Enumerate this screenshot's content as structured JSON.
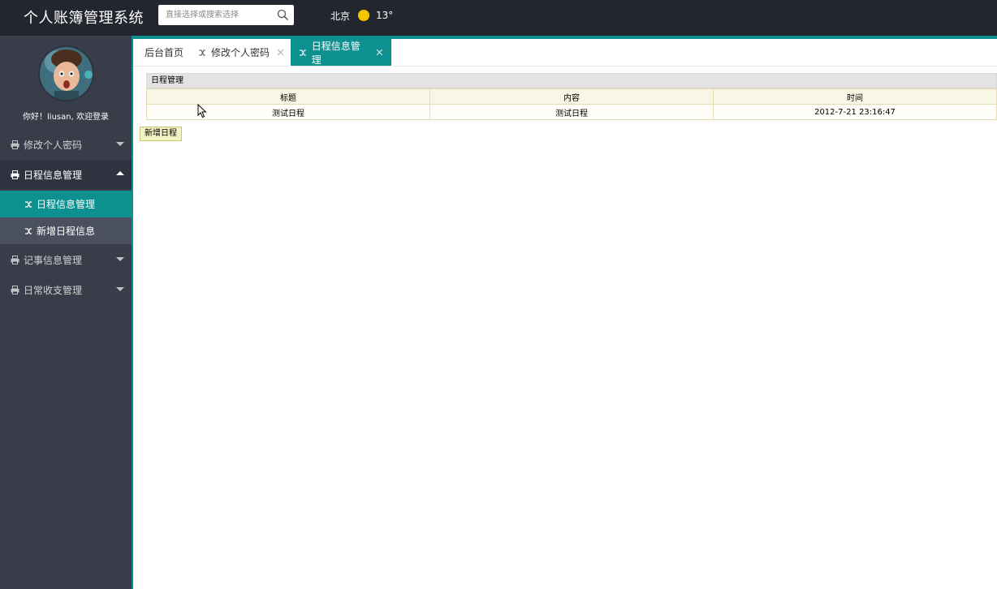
{
  "header": {
    "app_title": "个人账簿管理系统",
    "search_placeholder": "直接选择或搜索选择",
    "weather": {
      "city": "北京",
      "temperature": "13°",
      "icon": "sun-icon"
    }
  },
  "sidebar": {
    "welcome": "你好！liusan, 欢迎登录",
    "groups": [
      {
        "label": "修改个人密码",
        "expanded": false
      },
      {
        "label": "日程信息管理",
        "expanded": true,
        "items": [
          {
            "label": "日程信息管理",
            "active": true
          },
          {
            "label": "新增日程信息",
            "active": false
          }
        ]
      },
      {
        "label": "记事信息管理",
        "expanded": false
      },
      {
        "label": "日常收支管理",
        "expanded": false
      }
    ]
  },
  "tabs": [
    {
      "label": "后台首页",
      "closable": false,
      "active": false
    },
    {
      "label": "修改个人密码",
      "closable": true,
      "active": false
    },
    {
      "label": "日程信息管理",
      "closable": true,
      "active": true
    }
  ],
  "panel": {
    "title": "日程管理",
    "columns": [
      "标题",
      "内容",
      "时间"
    ],
    "rows": [
      [
        "测试日程",
        "测试日程",
        "2012-7-21 23:16:47"
      ]
    ],
    "add_button": "新增日程"
  },
  "colors": {
    "accent": "#0c9090",
    "topbar": "#23262e",
    "sidebar": "#393d49"
  }
}
